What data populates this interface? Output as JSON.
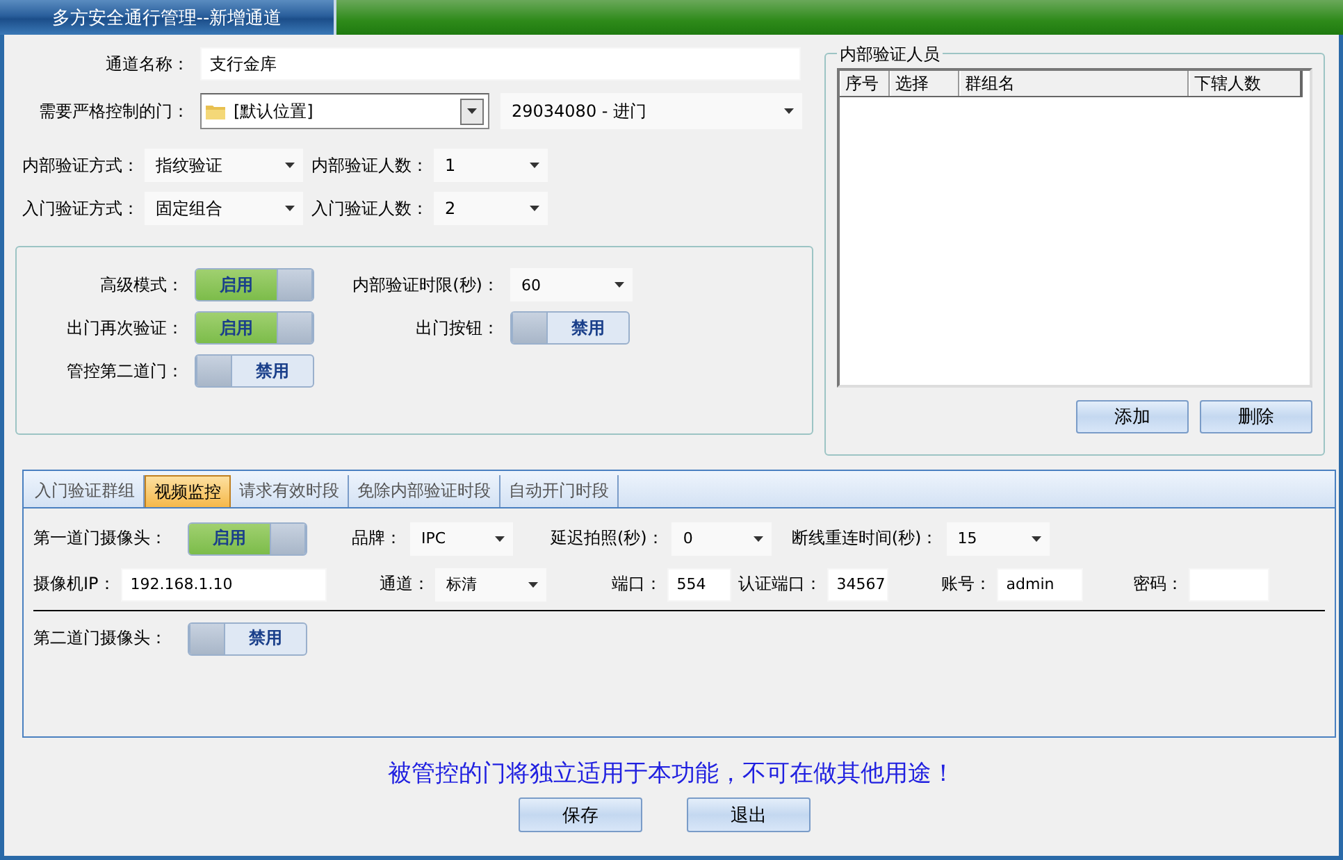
{
  "window": {
    "title": "多方安全通行管理--新增通道"
  },
  "form": {
    "channel_name": {
      "label": "通道名称：",
      "value": "支行金库"
    },
    "door": {
      "label": "需要严格控制的门：",
      "location": "[默认位置]",
      "door": "29034080 - 进门"
    },
    "selects": [
      {
        "label": "内部验证方式：",
        "value": "指纹验证"
      },
      {
        "label": "内部验证人数：",
        "value": "1"
      },
      {
        "label": "入门验证方式：",
        "value": "固定组合"
      },
      {
        "label": "入门验证人数：",
        "value": "2"
      }
    ]
  },
  "advanced": [
    [
      {
        "kind": "toggle",
        "label": "高级模式：",
        "on": true,
        "text": "启用"
      },
      {
        "kind": "select",
        "label": "内部验证时限(秒)：",
        "value": "60"
      }
    ],
    [
      {
        "kind": "toggle",
        "label": "出门再次验证：",
        "on": true,
        "text": "启用"
      },
      {
        "kind": "toggle",
        "label": "出门按钮：",
        "on": false,
        "text": "禁用"
      }
    ],
    [
      {
        "kind": "toggle",
        "label": "管控第二道门：",
        "on": false,
        "text": "禁用"
      }
    ]
  ],
  "members": {
    "title": "内部验证人员",
    "columns": [
      "序号",
      "选择",
      "群组名",
      "下辖人数"
    ],
    "buttons": [
      "添加",
      "删除"
    ]
  },
  "tabs": [
    {
      "label": "入门验证群组",
      "selected": false
    },
    {
      "label": "视频监控",
      "selected": true
    },
    {
      "label": "请求有效时段",
      "selected": false
    },
    {
      "label": "免除内部验证时段",
      "selected": false
    },
    {
      "label": "自动开门时段",
      "selected": false
    }
  ],
  "video": [
    [
      {
        "kind": "toggle",
        "label": "第一道门摄像头：",
        "on": true,
        "text": "启用"
      },
      {
        "kind": "select",
        "label": "品牌：",
        "value": "IPC"
      },
      {
        "kind": "select",
        "label": "延迟拍照(秒)：",
        "value": "0"
      },
      {
        "kind": "select",
        "label": "断线重连时间(秒)：",
        "value": "15"
      }
    ],
    [
      {
        "kind": "input",
        "label": "摄像机IP：",
        "value": "192.168.1.10"
      },
      {
        "kind": "select",
        "label": "通道：",
        "value": "标清"
      },
      {
        "kind": "input",
        "label": "端口：",
        "value": "554"
      },
      {
        "kind": "input",
        "label": "认证端口：",
        "value": "34567"
      },
      {
        "kind": "input",
        "label": "账号：",
        "value": "admin"
      },
      {
        "kind": "input",
        "label": "密码："
      }
    ],
    [
      {
        "kind": "toggle",
        "label": "第二道门摄像头：",
        "on": false,
        "text": "禁用"
      }
    ]
  ],
  "notice": "被管控的门将独立适用于本功能，不可在做其他用途！",
  "buttons": [
    "保存",
    "退出"
  ]
}
